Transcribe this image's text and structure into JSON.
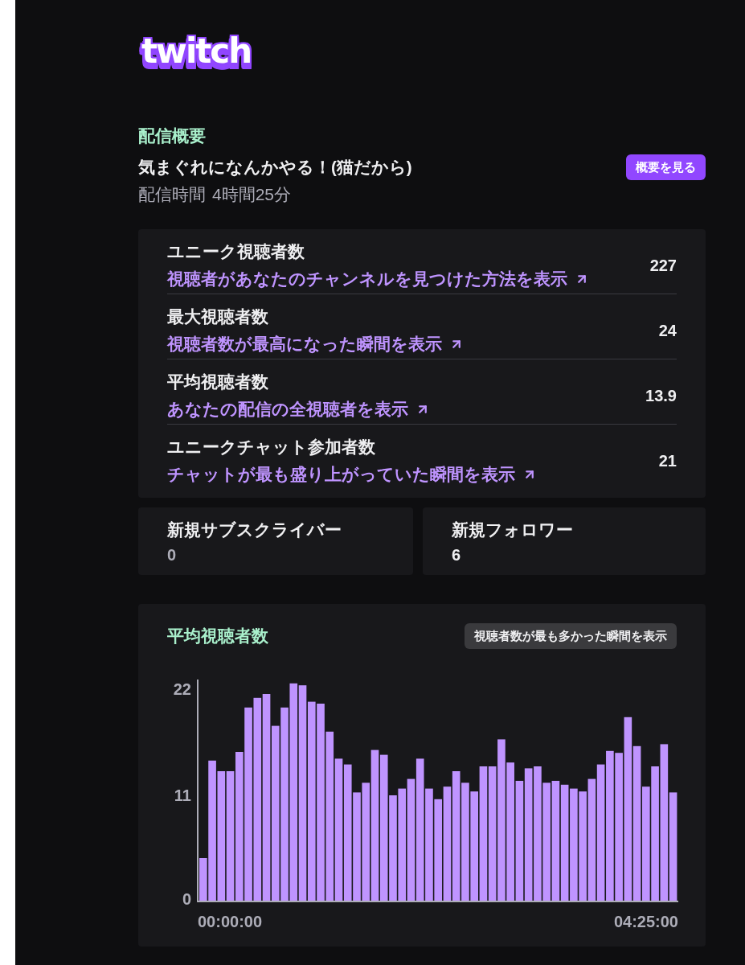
{
  "logo": "twitch",
  "summary": {
    "heading": "配信概要",
    "title": "気まぐれになんかやる！(猫だから)",
    "button": "概要を見る",
    "duration": {
      "label": "配信時間",
      "value": "4時間25分"
    }
  },
  "stats": [
    {
      "label": "ユニーク視聴者数",
      "link": "視聴者があなたのチャンネルを見つけた方法を表示",
      "value": "227"
    },
    {
      "label": "最大視聴者数",
      "link": "視聴者数が最高になった瞬間を表示",
      "value": "24"
    },
    {
      "label": "平均視聴者数",
      "link": "あなたの配信の全視聴者を表示",
      "value": "13.9"
    },
    {
      "label": "ユニークチャット参加者数",
      "link": "チャットが最も盛り上がっていた瞬間を表示",
      "value": "21"
    }
  ],
  "cards": [
    {
      "label": "新規サブスクライバー",
      "value": "0",
      "muted": true
    },
    {
      "label": "新規フォロワー",
      "value": "6",
      "muted": false
    }
  ],
  "chart_panel": {
    "title": "平均視聴者数",
    "button": "視聴者数が最も多かった瞬間を表示",
    "chart_data": {
      "type": "bar",
      "values": [
        4.5,
        14.6,
        13.5,
        13.5,
        15.5,
        20.1,
        21.1,
        21.5,
        18.2,
        20.1,
        22.6,
        22.4,
        20.7,
        20.5,
        17.6,
        14.8,
        14.2,
        11.3,
        12.3,
        15.7,
        15.2,
        11,
        11.7,
        12.7,
        14.8,
        11.7,
        10.6,
        11.9,
        13.5,
        12.3,
        11.4,
        14,
        14,
        16.8,
        14.4,
        12.5,
        13.8,
        14,
        12.3,
        12.5,
        12.1,
        11.7,
        11.4,
        12.7,
        14.2,
        15.6,
        15.4,
        19.1,
        16.1,
        11.9,
        14,
        16.3,
        11.3
      ],
      "ylim": [
        0,
        23
      ],
      "yticks": [
        0,
        11,
        22
      ]
    },
    "time_range": {
      "start": "00:00:00",
      "end": "04:25:00"
    }
  }
}
